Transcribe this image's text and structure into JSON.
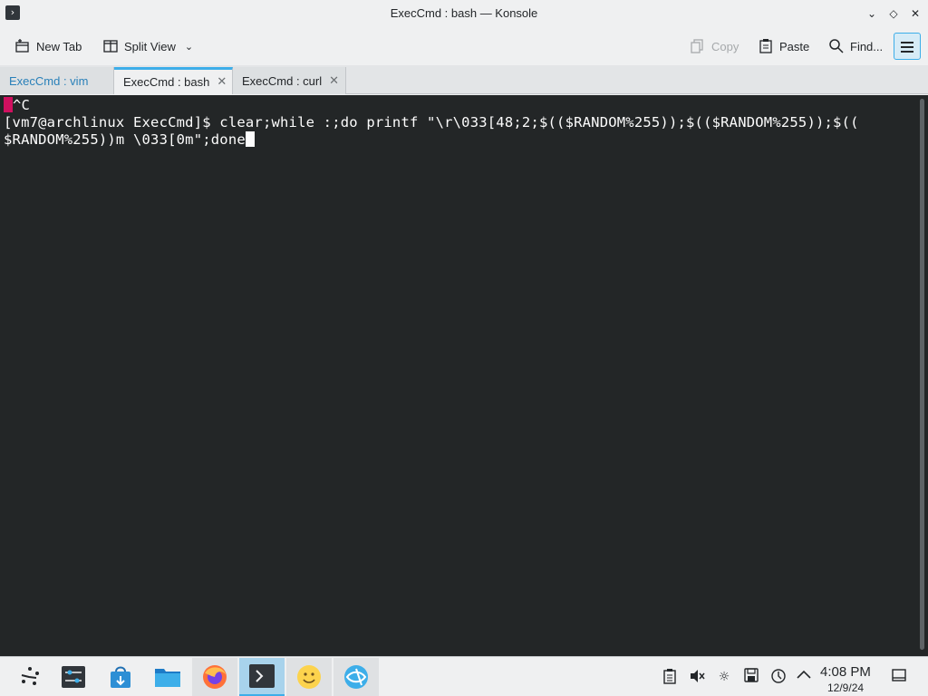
{
  "window": {
    "title": "ExecCmd : bash — Konsole",
    "app_icon": "terminal-icon",
    "buttons": [
      "minimize",
      "maximize",
      "close"
    ]
  },
  "toolbar": {
    "new_tab": "New Tab",
    "split_view": "Split View",
    "copy": "Copy",
    "paste": "Paste",
    "find": "Find..."
  },
  "tabs": [
    {
      "label": "ExecCmd : vim",
      "active": false
    },
    {
      "label": "ExecCmd : bash",
      "active": true
    },
    {
      "label": "ExecCmd : curl",
      "active": false
    }
  ],
  "terminal": {
    "lines": [
      "^C",
      "[vm7@archlinux ExecCmd]$ clear;while :;do printf \"\\r\\033[48;2;$(($RANDOM%255));$(($RANDOM%255));$((",
      "$RANDOM%255))m \\033[0m\";done"
    ]
  },
  "taskbar": {
    "items": [
      "app-launcher-icon",
      "system-settings-icon",
      "discover-icon",
      "dolphin-icon",
      "firefox-icon",
      "konsole-icon",
      "smiley-app-icon",
      "browser-icon"
    ],
    "clock_time": "4:08 PM",
    "clock_date": "12/9/24"
  },
  "colors": {
    "terminal_bg": "#232627",
    "accent": "#3daee9",
    "red_block": "#d0105f"
  }
}
